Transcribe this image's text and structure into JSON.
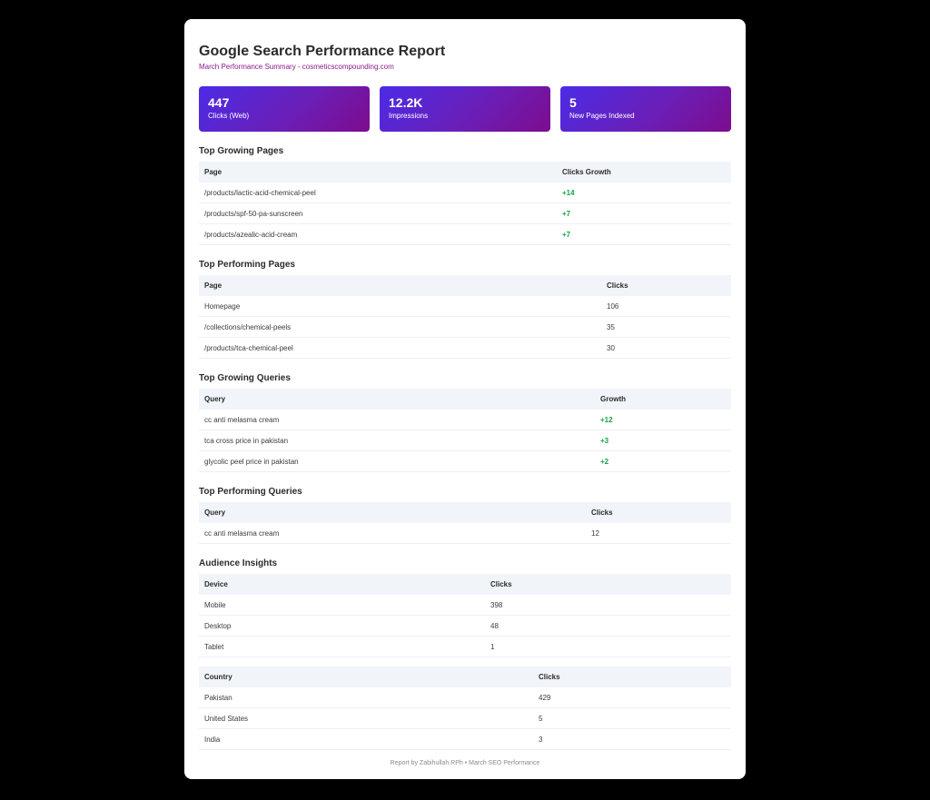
{
  "report": {
    "title": "Google Search Performance Report",
    "subtitle": "March Performance Summary - cosmeticscompounding.com"
  },
  "stats": [
    {
      "value": "447",
      "label": "Clicks (Web)"
    },
    {
      "value": "12.2K",
      "label": "Impressions"
    },
    {
      "value": "5",
      "label": "New Pages Indexed"
    }
  ],
  "growing_pages": {
    "heading": "Top Growing Pages",
    "columns": [
      "Page",
      "Clicks Growth"
    ],
    "rows": [
      [
        "/products/lactic-acid-chemical-peel",
        "+14"
      ],
      [
        "/products/spf-50-pa-sunscreen",
        "+7"
      ],
      [
        "/products/azealic-acid-cream",
        "+7"
      ]
    ]
  },
  "performing_pages": {
    "heading": "Top Performing Pages",
    "columns": [
      "Page",
      "Clicks"
    ],
    "rows": [
      [
        "Homepage",
        "106"
      ],
      [
        "/collections/chemical-peels",
        "35"
      ],
      [
        "/products/tca-chemical-peel",
        "30"
      ]
    ]
  },
  "growing_queries": {
    "heading": "Top Growing Queries",
    "columns": [
      "Query",
      "Growth"
    ],
    "rows": [
      [
        "cc anti melasma cream",
        "+12"
      ],
      [
        "tca cross price in pakistan",
        "+3"
      ],
      [
        "glycolic peel price in pakistan",
        "+2"
      ]
    ]
  },
  "performing_queries": {
    "heading": "Top Performing Queries",
    "columns": [
      "Query",
      "Clicks"
    ],
    "rows": [
      [
        "cc anti melasma cream",
        "12"
      ]
    ]
  },
  "audience": {
    "heading": "Audience Insights",
    "device": {
      "columns": [
        "Device",
        "Clicks"
      ],
      "rows": [
        [
          "Mobile",
          "398"
        ],
        [
          "Desktop",
          "48"
        ],
        [
          "Tablet",
          "1"
        ]
      ]
    },
    "country": {
      "columns": [
        "Country",
        "Clicks"
      ],
      "rows": [
        [
          "Pakistan",
          "429"
        ],
        [
          "United States",
          "5"
        ],
        [
          "India",
          "3"
        ]
      ]
    }
  },
  "footer": "Report by Zabihullah RPh • March SEO Performance",
  "colors": {
    "accent_start": "#4b2be6",
    "accent_end": "#7d0c8e",
    "growth": "#16a34a",
    "subtitle": "#8b1a8b"
  }
}
